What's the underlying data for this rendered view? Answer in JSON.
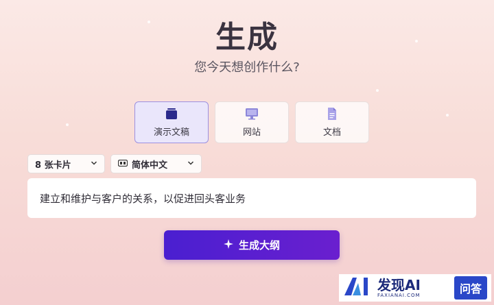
{
  "header": {
    "title": "生成",
    "subtitle": "您今天想创作什么?"
  },
  "types": [
    {
      "label": "演示文稿",
      "icon": "presentation-icon",
      "active": true
    },
    {
      "label": "网站",
      "icon": "monitor-icon",
      "active": false
    },
    {
      "label": "文档",
      "icon": "document-icon",
      "active": false
    }
  ],
  "options": {
    "cards": "8 张卡片",
    "language": "简体中文"
  },
  "prompt": {
    "value": "建立和维护与客户的关系，以促进回头客业务"
  },
  "generate_button": {
    "label": "生成大纲",
    "icon": "sparkle-icon"
  },
  "watermark": {
    "brand": "发现AI",
    "domain": "FAXIANAI.COM",
    "tag": "问答"
  },
  "colors": {
    "accent": "#5a1fd0",
    "active_card": "#eae6fb"
  }
}
